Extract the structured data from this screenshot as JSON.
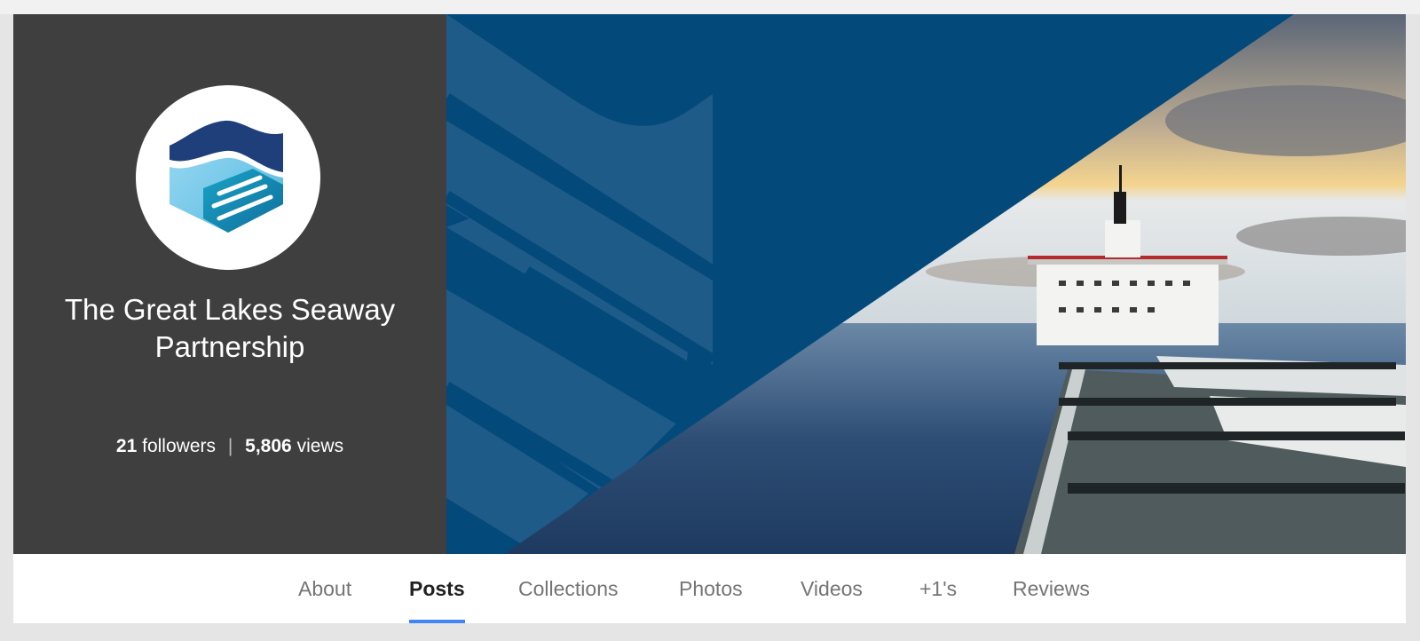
{
  "profile": {
    "name": "The Great Lakes Seaway Partnership",
    "followers_count": "21",
    "followers_label": "followers",
    "separator": "|",
    "views_count": "5,806",
    "views_label": "views"
  },
  "tabs": [
    {
      "label": "About",
      "active": false
    },
    {
      "label": "Posts",
      "active": true
    },
    {
      "label": "Collections",
      "active": false
    },
    {
      "label": "Photos",
      "active": false
    },
    {
      "label": "Videos",
      "active": false
    },
    {
      "label": "+1's",
      "active": false
    },
    {
      "label": "Reviews",
      "active": false
    }
  ],
  "colors": {
    "panel": "#3f3f3f",
    "cover_blue": "#034a7a",
    "tab_indicator": "#4285f4"
  }
}
